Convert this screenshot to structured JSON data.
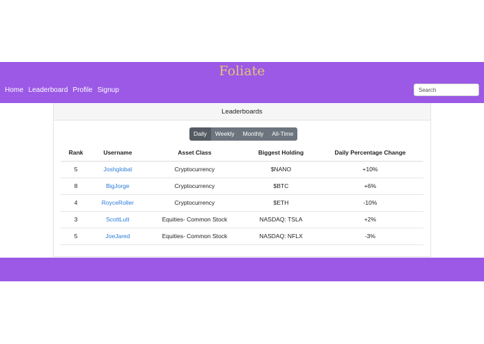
{
  "header": {
    "brand": "Foliate",
    "nav": [
      "Home",
      "Leaderboard",
      "Profile",
      "Signup"
    ],
    "search_placeholder": "Search"
  },
  "card": {
    "title": "Leaderboards",
    "periods": [
      "Daily",
      "Weekly",
      "Monthly",
      "All-Time"
    ],
    "active_period": "Daily"
  },
  "table": {
    "columns": [
      "Rank",
      "Username",
      "Asset Class",
      "Biggest Holding",
      "Daily Percentage Change"
    ],
    "rows": [
      [
        "5",
        "Joshglobal",
        "Cryptocurrency",
        "$NANO",
        "+10%"
      ],
      [
        "8",
        "BigJorge",
        "Cryptocurrency",
        "$BTC",
        "+6%"
      ],
      [
        "4",
        "RoyceRoller",
        "Cryptocurrency",
        "$ETH",
        "-10%"
      ],
      [
        "3",
        "ScottLutt",
        "Equities- Common Stock",
        "NASDAQ: TSLA",
        "+2%"
      ],
      [
        "5",
        "JoeJared",
        "Equities- Common Stock",
        "NASDAQ: NFLX",
        "-3%"
      ]
    ]
  },
  "colors": {
    "brand_purple": "#9b59e6",
    "brand_text": "#e6c27a",
    "link_blue": "#2a7bd8"
  }
}
